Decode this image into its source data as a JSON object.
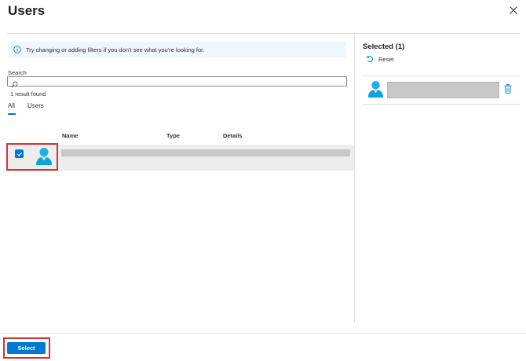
{
  "header": {
    "title": "Users"
  },
  "info": {
    "message": "Try changing or adding filters if you don't see what you're looking for."
  },
  "search": {
    "label": "Search",
    "value": "",
    "placeholder": "",
    "result_count": "1 result found"
  },
  "tabs": [
    {
      "label": "All",
      "active": true
    },
    {
      "label": "Users",
      "active": false
    }
  ],
  "table": {
    "columns": [
      "Name",
      "Type",
      "Details"
    ],
    "rows": [
      {
        "checked": true,
        "name": "",
        "type": "",
        "details": ""
      }
    ]
  },
  "selected": {
    "title": "Selected (1)",
    "reset_label": "Reset"
  },
  "footer": {
    "select_label": "Select"
  },
  "colors": {
    "accent": "#0078d4",
    "highlight": "#d13438",
    "avatar_head": "#1db0e6",
    "avatar_body": "#0fa3d8"
  },
  "icons": [
    "close-icon",
    "info-icon",
    "search-icon",
    "checkmark-icon",
    "user-avatar-icon",
    "reset-icon",
    "trash-icon"
  ]
}
